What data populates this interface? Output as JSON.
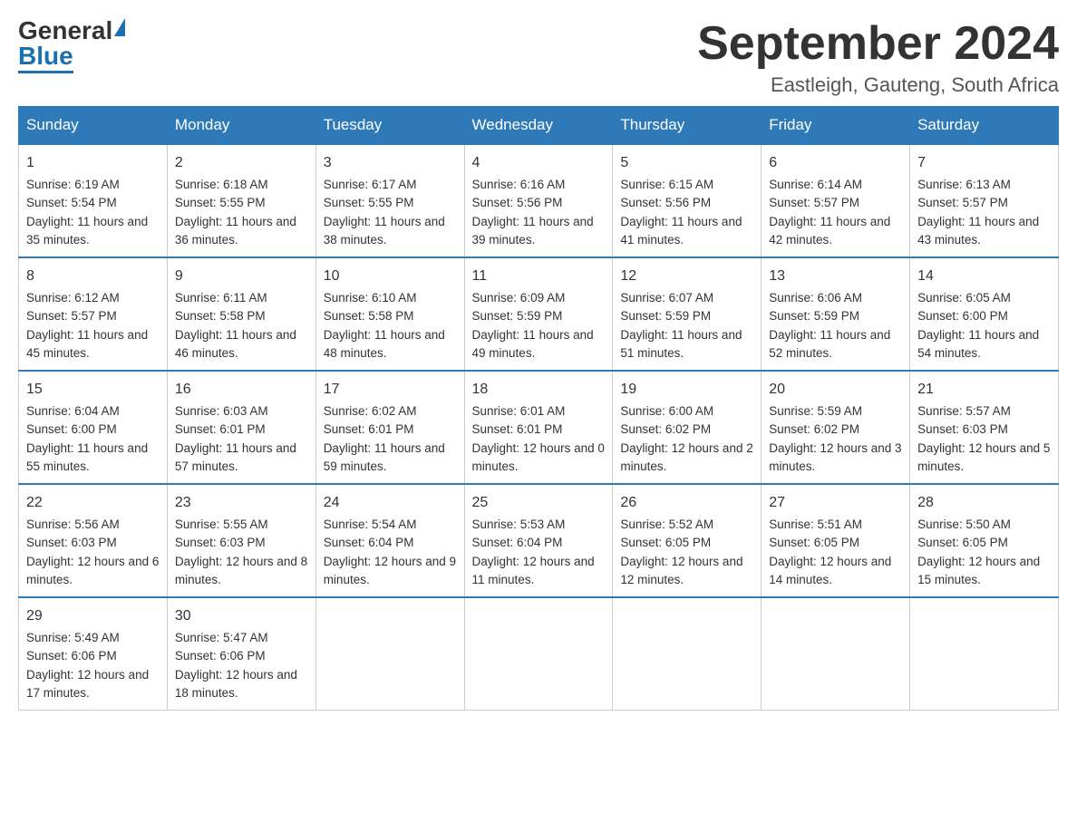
{
  "logo": {
    "general": "General",
    "blue": "Blue"
  },
  "title": "September 2024",
  "location": "Eastleigh, Gauteng, South Africa",
  "days": [
    "Sunday",
    "Monday",
    "Tuesday",
    "Wednesday",
    "Thursday",
    "Friday",
    "Saturday"
  ],
  "weeks": [
    [
      {
        "day": "1",
        "sunrise": "6:19 AM",
        "sunset": "5:54 PM",
        "daylight": "11 hours and 35 minutes."
      },
      {
        "day": "2",
        "sunrise": "6:18 AM",
        "sunset": "5:55 PM",
        "daylight": "11 hours and 36 minutes."
      },
      {
        "day": "3",
        "sunrise": "6:17 AM",
        "sunset": "5:55 PM",
        "daylight": "11 hours and 38 minutes."
      },
      {
        "day": "4",
        "sunrise": "6:16 AM",
        "sunset": "5:56 PM",
        "daylight": "11 hours and 39 minutes."
      },
      {
        "day": "5",
        "sunrise": "6:15 AM",
        "sunset": "5:56 PM",
        "daylight": "11 hours and 41 minutes."
      },
      {
        "day": "6",
        "sunrise": "6:14 AM",
        "sunset": "5:57 PM",
        "daylight": "11 hours and 42 minutes."
      },
      {
        "day": "7",
        "sunrise": "6:13 AM",
        "sunset": "5:57 PM",
        "daylight": "11 hours and 43 minutes."
      }
    ],
    [
      {
        "day": "8",
        "sunrise": "6:12 AM",
        "sunset": "5:57 PM",
        "daylight": "11 hours and 45 minutes."
      },
      {
        "day": "9",
        "sunrise": "6:11 AM",
        "sunset": "5:58 PM",
        "daylight": "11 hours and 46 minutes."
      },
      {
        "day": "10",
        "sunrise": "6:10 AM",
        "sunset": "5:58 PM",
        "daylight": "11 hours and 48 minutes."
      },
      {
        "day": "11",
        "sunrise": "6:09 AM",
        "sunset": "5:59 PM",
        "daylight": "11 hours and 49 minutes."
      },
      {
        "day": "12",
        "sunrise": "6:07 AM",
        "sunset": "5:59 PM",
        "daylight": "11 hours and 51 minutes."
      },
      {
        "day": "13",
        "sunrise": "6:06 AM",
        "sunset": "5:59 PM",
        "daylight": "11 hours and 52 minutes."
      },
      {
        "day": "14",
        "sunrise": "6:05 AM",
        "sunset": "6:00 PM",
        "daylight": "11 hours and 54 minutes."
      }
    ],
    [
      {
        "day": "15",
        "sunrise": "6:04 AM",
        "sunset": "6:00 PM",
        "daylight": "11 hours and 55 minutes."
      },
      {
        "day": "16",
        "sunrise": "6:03 AM",
        "sunset": "6:01 PM",
        "daylight": "11 hours and 57 minutes."
      },
      {
        "day": "17",
        "sunrise": "6:02 AM",
        "sunset": "6:01 PM",
        "daylight": "11 hours and 59 minutes."
      },
      {
        "day": "18",
        "sunrise": "6:01 AM",
        "sunset": "6:01 PM",
        "daylight": "12 hours and 0 minutes."
      },
      {
        "day": "19",
        "sunrise": "6:00 AM",
        "sunset": "6:02 PM",
        "daylight": "12 hours and 2 minutes."
      },
      {
        "day": "20",
        "sunrise": "5:59 AM",
        "sunset": "6:02 PM",
        "daylight": "12 hours and 3 minutes."
      },
      {
        "day": "21",
        "sunrise": "5:57 AM",
        "sunset": "6:03 PM",
        "daylight": "12 hours and 5 minutes."
      }
    ],
    [
      {
        "day": "22",
        "sunrise": "5:56 AM",
        "sunset": "6:03 PM",
        "daylight": "12 hours and 6 minutes."
      },
      {
        "day": "23",
        "sunrise": "5:55 AM",
        "sunset": "6:03 PM",
        "daylight": "12 hours and 8 minutes."
      },
      {
        "day": "24",
        "sunrise": "5:54 AM",
        "sunset": "6:04 PM",
        "daylight": "12 hours and 9 minutes."
      },
      {
        "day": "25",
        "sunrise": "5:53 AM",
        "sunset": "6:04 PM",
        "daylight": "12 hours and 11 minutes."
      },
      {
        "day": "26",
        "sunrise": "5:52 AM",
        "sunset": "6:05 PM",
        "daylight": "12 hours and 12 minutes."
      },
      {
        "day": "27",
        "sunrise": "5:51 AM",
        "sunset": "6:05 PM",
        "daylight": "12 hours and 14 minutes."
      },
      {
        "day": "28",
        "sunrise": "5:50 AM",
        "sunset": "6:05 PM",
        "daylight": "12 hours and 15 minutes."
      }
    ],
    [
      {
        "day": "29",
        "sunrise": "5:49 AM",
        "sunset": "6:06 PM",
        "daylight": "12 hours and 17 minutes."
      },
      {
        "day": "30",
        "sunrise": "5:47 AM",
        "sunset": "6:06 PM",
        "daylight": "12 hours and 18 minutes."
      },
      null,
      null,
      null,
      null,
      null
    ]
  ]
}
